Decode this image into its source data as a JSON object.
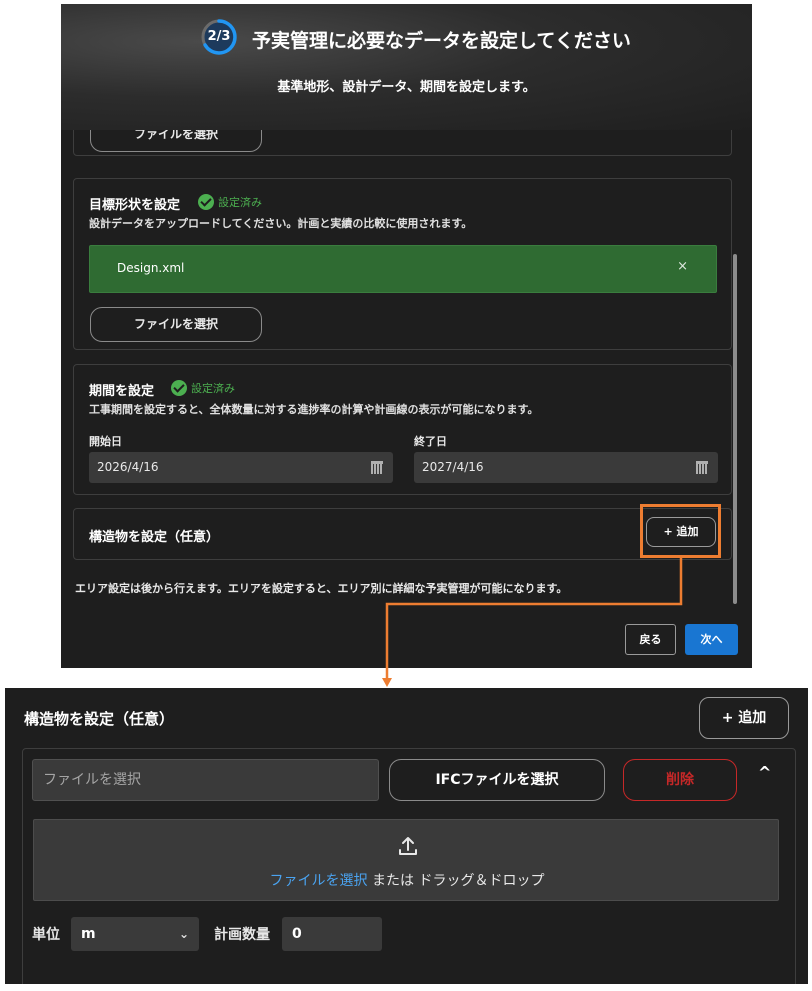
{
  "header": {
    "progress": "2/3",
    "progress_fraction": 0.667,
    "title": "予実管理に必要なデータを設定してください",
    "subtitle": "基準地形、設計データ、期間を設定します。"
  },
  "sections": {
    "top_partial": {
      "file_button": "ファイルを選択"
    },
    "target_shape": {
      "title": "目標形状を設定",
      "status": "設定済み",
      "description": "設計データをアップロードしてください。計画と実績の比較に使用されます。",
      "file_name": "Design.xml",
      "remove_label": "×",
      "file_button": "ファイルを選択"
    },
    "period": {
      "title": "期間を設定",
      "status": "設定済み",
      "description": "工事期間を設定すると、全体数量に対する進捗率の計算や計画線の表示が可能になります。",
      "start_label": "開始日",
      "start_value": "2026/4/16",
      "end_label": "終了日",
      "end_value": "2027/4/16"
    },
    "structure": {
      "title": "構造物を設定（任意）",
      "add_button": "+ 追加"
    }
  },
  "note": "エリア設定は後から行えます。エリアを設定すると、エリア別に詳細な予実管理が可能になります。",
  "footer": {
    "back": "戻る",
    "next": "次へ"
  },
  "zoom": {
    "title": "構造物を設定（任意）",
    "add_button": "+ 追加",
    "file_input_placeholder": "ファイルを選択",
    "ifc_button": "IFCファイルを選択",
    "delete_button": "削除",
    "collapse_icon": "^",
    "drop_link": "ファイルを選択",
    "drop_text": " または ドラッグ＆ドロップ",
    "unit_label": "単位",
    "unit_value": "m",
    "quantity_label": "計画数量",
    "quantity_value": "0"
  },
  "colors": {
    "accent": "#1976d2",
    "success": "#4caf50",
    "danger": "#c62828",
    "highlight": "#ed7d31",
    "file_chip": "#2f6b32"
  }
}
